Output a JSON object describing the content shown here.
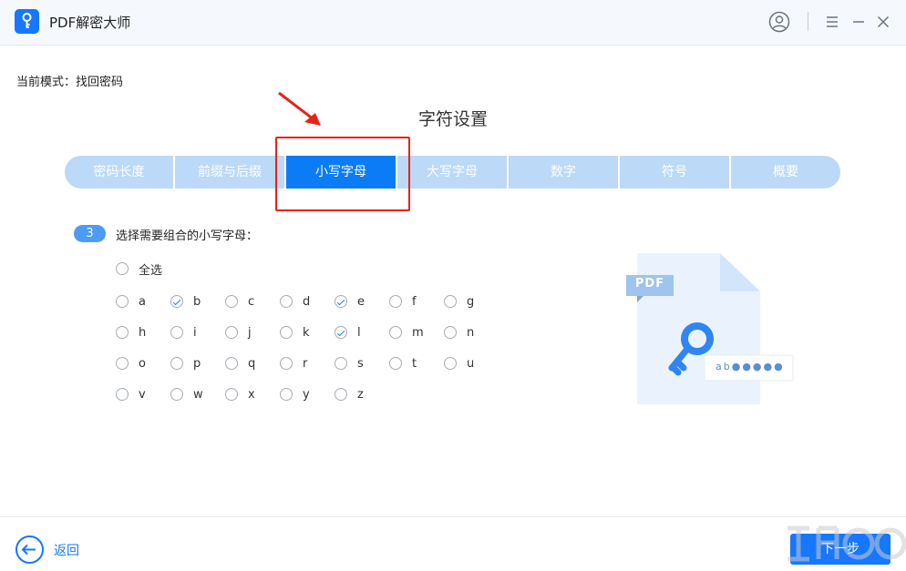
{
  "window": {
    "title": "PDF解密大师"
  },
  "mode": {
    "text": "当前模式：找回密码"
  },
  "section": {
    "title": "字符设置"
  },
  "tabs": [
    {
      "label": "密码长度",
      "active": false
    },
    {
      "label": "前缀与后缀",
      "active": false
    },
    {
      "label": "小写字母",
      "active": true
    },
    {
      "label": "大写字母",
      "active": false
    },
    {
      "label": "数字",
      "active": false
    },
    {
      "label": "符号",
      "active": false
    },
    {
      "label": "概要",
      "active": false
    }
  ],
  "step": {
    "number": "3",
    "text": "选择需要组合的小写字母："
  },
  "select_all": {
    "label": "全选",
    "checked": false
  },
  "letters": [
    {
      "label": "a",
      "checked": false
    },
    {
      "label": "b",
      "checked": true
    },
    {
      "label": "c",
      "checked": false
    },
    {
      "label": "d",
      "checked": false
    },
    {
      "label": "e",
      "checked": true
    },
    {
      "label": "f",
      "checked": false
    },
    {
      "label": "g",
      "checked": false
    },
    {
      "label": "h",
      "checked": false
    },
    {
      "label": "i",
      "checked": false
    },
    {
      "label": "j",
      "checked": false
    },
    {
      "label": "k",
      "checked": false
    },
    {
      "label": "l",
      "checked": true
    },
    {
      "label": "m",
      "checked": false
    },
    {
      "label": "n",
      "checked": false
    },
    {
      "label": "o",
      "checked": false
    },
    {
      "label": "p",
      "checked": false
    },
    {
      "label": "q",
      "checked": false
    },
    {
      "label": "r",
      "checked": false
    },
    {
      "label": "s",
      "checked": false
    },
    {
      "label": "t",
      "checked": false
    },
    {
      "label": "u",
      "checked": false
    },
    {
      "label": "v",
      "checked": false
    },
    {
      "label": "w",
      "checked": false
    },
    {
      "label": "x",
      "checked": false
    },
    {
      "label": "y",
      "checked": false
    },
    {
      "label": "z",
      "checked": false
    }
  ],
  "illustration": {
    "badge": "PDF",
    "password": "ab●●●●●"
  },
  "footer": {
    "back_label": "返回",
    "next_label": "下一步"
  },
  "colors": {
    "accent": "#1677ff",
    "tab_bg": "#bcd9f7",
    "highlight": "#e8221a"
  }
}
